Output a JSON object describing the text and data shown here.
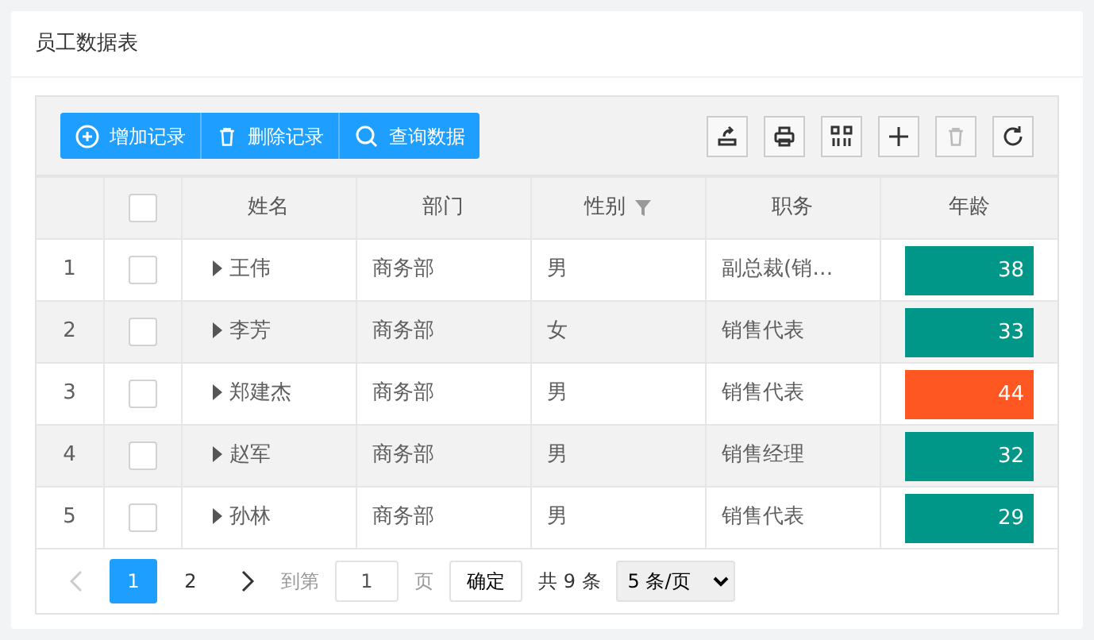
{
  "panel": {
    "title": "员工数据表"
  },
  "toolbar": {
    "buttons": [
      {
        "label": "增加记录",
        "kind": "add"
      },
      {
        "label": "删除记录",
        "kind": "delete"
      },
      {
        "label": "查询数据",
        "kind": "search"
      }
    ],
    "tools": [
      {
        "kind": "export",
        "disabled": false
      },
      {
        "kind": "print",
        "disabled": false
      },
      {
        "kind": "columns",
        "disabled": false
      },
      {
        "kind": "add",
        "disabled": false
      },
      {
        "kind": "delete",
        "disabled": true
      },
      {
        "kind": "refresh",
        "disabled": false
      }
    ]
  },
  "table": {
    "header_checked": false,
    "columns": [
      {
        "label": "姓名",
        "filter": false
      },
      {
        "label": "部门",
        "filter": false
      },
      {
        "label": "性别",
        "filter": true
      },
      {
        "label": "职务",
        "filter": false
      },
      {
        "label": "年龄",
        "filter": false
      }
    ],
    "rows": [
      {
        "index": "1",
        "checked": false,
        "name": "王伟",
        "department": "商务部",
        "gender": "男",
        "position": "副总裁(销…",
        "age": "38",
        "color": "#009688"
      },
      {
        "index": "2",
        "checked": false,
        "name": "李芳",
        "department": "商务部",
        "gender": "女",
        "position": "销售代表",
        "age": "33",
        "color": "#009688"
      },
      {
        "index": "3",
        "checked": false,
        "name": "郑建杰",
        "department": "商务部",
        "gender": "男",
        "position": "销售代表",
        "age": "44",
        "color": "#ff5722"
      },
      {
        "index": "4",
        "checked": false,
        "name": "赵军",
        "department": "商务部",
        "gender": "男",
        "position": "销售经理",
        "age": "32",
        "color": "#009688"
      },
      {
        "index": "5",
        "checked": false,
        "name": "孙林",
        "department": "商务部",
        "gender": "男",
        "position": "销售代表",
        "age": "29",
        "color": "#009688"
      }
    ]
  },
  "pager": {
    "prev_disabled": true,
    "pages": [
      {
        "label": "1",
        "selected": true
      },
      {
        "label": "2",
        "selected": false
      }
    ],
    "goto_label": "到第",
    "goto_value": "1",
    "page_label": "页",
    "confirm": "确定",
    "total": "共 9 条",
    "page_size": "5 条/页"
  }
}
